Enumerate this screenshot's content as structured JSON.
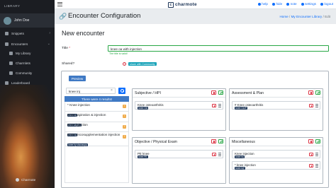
{
  "sidebar": {
    "library_label": "LIBRARY",
    "user_name": "John Doe",
    "items": [
      {
        "label": "Snippets",
        "icon": "snippets-icon"
      },
      {
        "label": "Encounters",
        "icon": "encounters-icon"
      },
      {
        "label": "My Library",
        "icon": "library-icon"
      },
      {
        "label": "Charmlets",
        "icon": "charmlets-icon"
      },
      {
        "label": "Community",
        "icon": "community-icon"
      },
      {
        "label": "Leaderboard",
        "icon": "leaderboard-icon"
      }
    ],
    "footer": "Charmote"
  },
  "topbar": {
    "logo_text": "charmote",
    "links": [
      "help",
      "hide",
      "note",
      "settings",
      "logout"
    ]
  },
  "titlebar": {
    "title": "Encounter Configuration",
    "breadcrumb": [
      "Home",
      "My Encounter Library",
      "Edit"
    ]
  },
  "form": {
    "heading": "New encounter",
    "title_label": "Title",
    "title_value": "knee oa with injection",
    "title_valid": "The title is valid!",
    "shared_label": "Shared?",
    "shared_help": "?",
    "shared_badge": "share with Community",
    "preview_label": "Preview"
  },
  "search": {
    "query": "knee inj",
    "results_header": "There were 4 results!",
    "results": [
      {
        "name": "* Knee injection",
        "tag": "knee inj",
        "warn": "!"
      },
      {
        "name": "Knee aspiration & injection",
        "tag": "knee asp/inj",
        "warn": "!"
      },
      {
        "name": "Knee injection",
        "tag": "knee inj",
        "warn": "!"
      },
      {
        "name": "Knee viscosupplementation injection",
        "tag": "knee hy viscosupp",
        "warn": "!"
      }
    ]
  },
  "sections": [
    {
      "title": "Subjective / HPI",
      "items": [
        {
          "name": "Knee osteoarthritis",
          "tag": "knee OA"
        }
      ]
    },
    {
      "title": "Assessment & Plan",
      "items": [
        {
          "name": "# Knee osteoarthritis",
          "tag": "knee OA/P"
        }
      ]
    },
    {
      "title": "Objective / Physical Exam",
      "items": [
        {
          "name": "PE knee",
          "tag": "knee PE"
        }
      ]
    },
    {
      "title": "Miscellaneous",
      "items": [
        {
          "name": "Knee injection",
          "tag": "knee inj"
        },
        {
          "name": "* knee injection",
          "tag": "knee inj*"
        }
      ]
    }
  ],
  "colors": {
    "primary": "#0d6efd",
    "accent_blue": "#3f79c4",
    "tag_navy": "#1d3557",
    "danger": "#dc3545",
    "success": "#28a745",
    "warning": "#f0ad4e",
    "sidebar_bg": "#1b1d22"
  }
}
